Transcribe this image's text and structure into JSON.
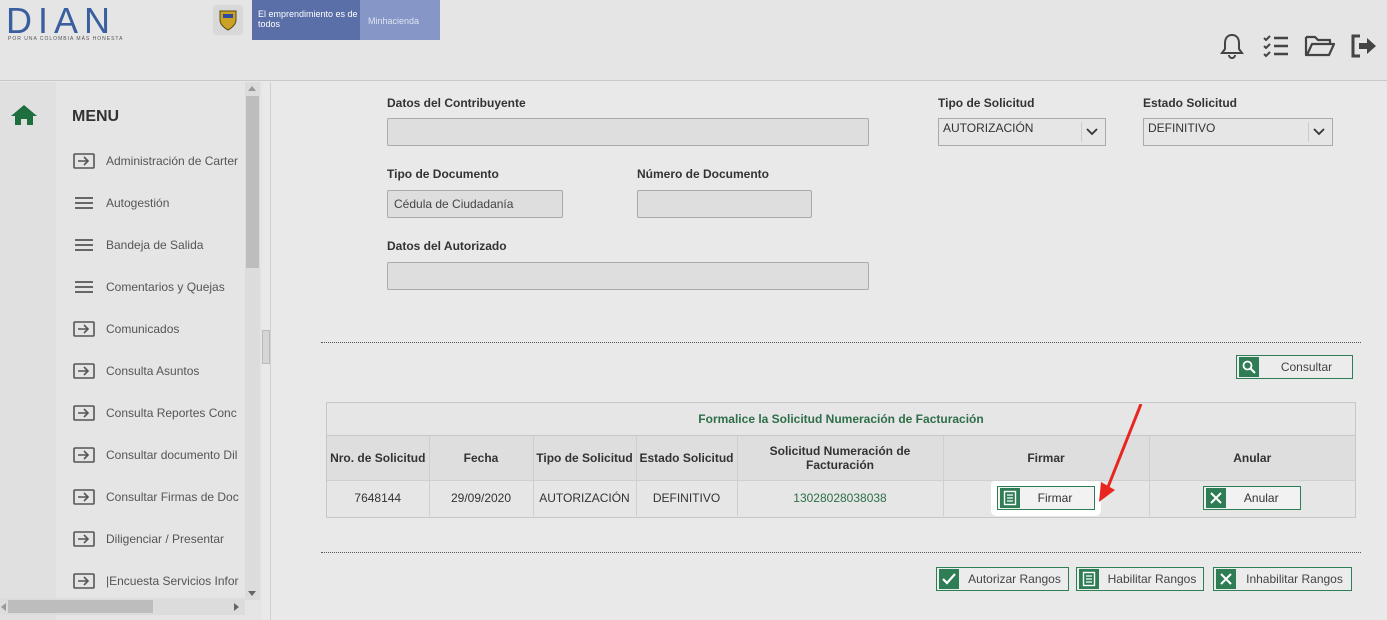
{
  "header": {
    "logo": "DIAN",
    "logo_tagline": "POR UNA COLOMBIA MÁS HONESTA",
    "gov_text": "El emprendimiento es de todos",
    "ministry": "Minhacienda",
    "icons": [
      "bell-icon",
      "checklist-icon",
      "folder-open-icon",
      "logout-icon"
    ]
  },
  "sidebar": {
    "title": "MENU",
    "items": [
      {
        "label": "Administración de Carter",
        "icon": "enter-icon"
      },
      {
        "label": "Autogestión",
        "icon": "hamburger-icon"
      },
      {
        "label": "Bandeja de Salida",
        "icon": "hamburger-icon"
      },
      {
        "label": "Comentarios y Quejas",
        "icon": "hamburger-icon"
      },
      {
        "label": "Comunicados",
        "icon": "enter-icon"
      },
      {
        "label": "Consulta Asuntos",
        "icon": "enter-icon"
      },
      {
        "label": "Consulta Reportes Conc",
        "icon": "enter-icon"
      },
      {
        "label": "Consultar documento Dil",
        "icon": "enter-icon"
      },
      {
        "label": "Consultar Firmas de Doc",
        "icon": "enter-icon"
      },
      {
        "label": "Diligenciar / Presentar",
        "icon": "enter-icon"
      },
      {
        "label": "|Encuesta Servicios Infor",
        "icon": "enter-icon"
      }
    ]
  },
  "form": {
    "contribuyente_label": "Datos del Contribuyente",
    "contribuyente_value": "",
    "tipo_solicitud_label": "Tipo de Solicitud",
    "tipo_solicitud_value": "AUTORIZACIÓN",
    "estado_solicitud_label": "Estado Solicitud",
    "estado_solicitud_value": "DEFINITIVO",
    "tipo_documento_label": "Tipo de Documento",
    "tipo_documento_value": "Cédula de Ciudadanía",
    "numero_documento_label": "Número de Documento",
    "numero_documento_value": "",
    "autorizado_label": "Datos del Autorizado",
    "autorizado_value": ""
  },
  "consultar_label": "Consultar",
  "results": {
    "title": "Formalice la Solicitud Numeración de Facturación",
    "columns": [
      "Nro. de Solicitud",
      "Fecha",
      "Tipo de Solicitud",
      "Estado Solicitud",
      "Solicitud Numeración de Facturación",
      "Firmar",
      "Anular"
    ],
    "row": {
      "nro": "7648144",
      "fecha": "29/09/2020",
      "tipo": "AUTORIZACIÓN",
      "estado": "DEFINITIVO",
      "numeracion": "13028028038038",
      "firmar_label": "Firmar",
      "anular_label": "Anular"
    }
  },
  "footer_buttons": {
    "autorizar": "Autorizar Rangos",
    "habilitar": "Habilitar Rangos",
    "inhabilitar": "Inhabilitar Rangos"
  },
  "colors": {
    "accent_green": "#2e7d55",
    "annotation_arrow": "#e8261f"
  }
}
